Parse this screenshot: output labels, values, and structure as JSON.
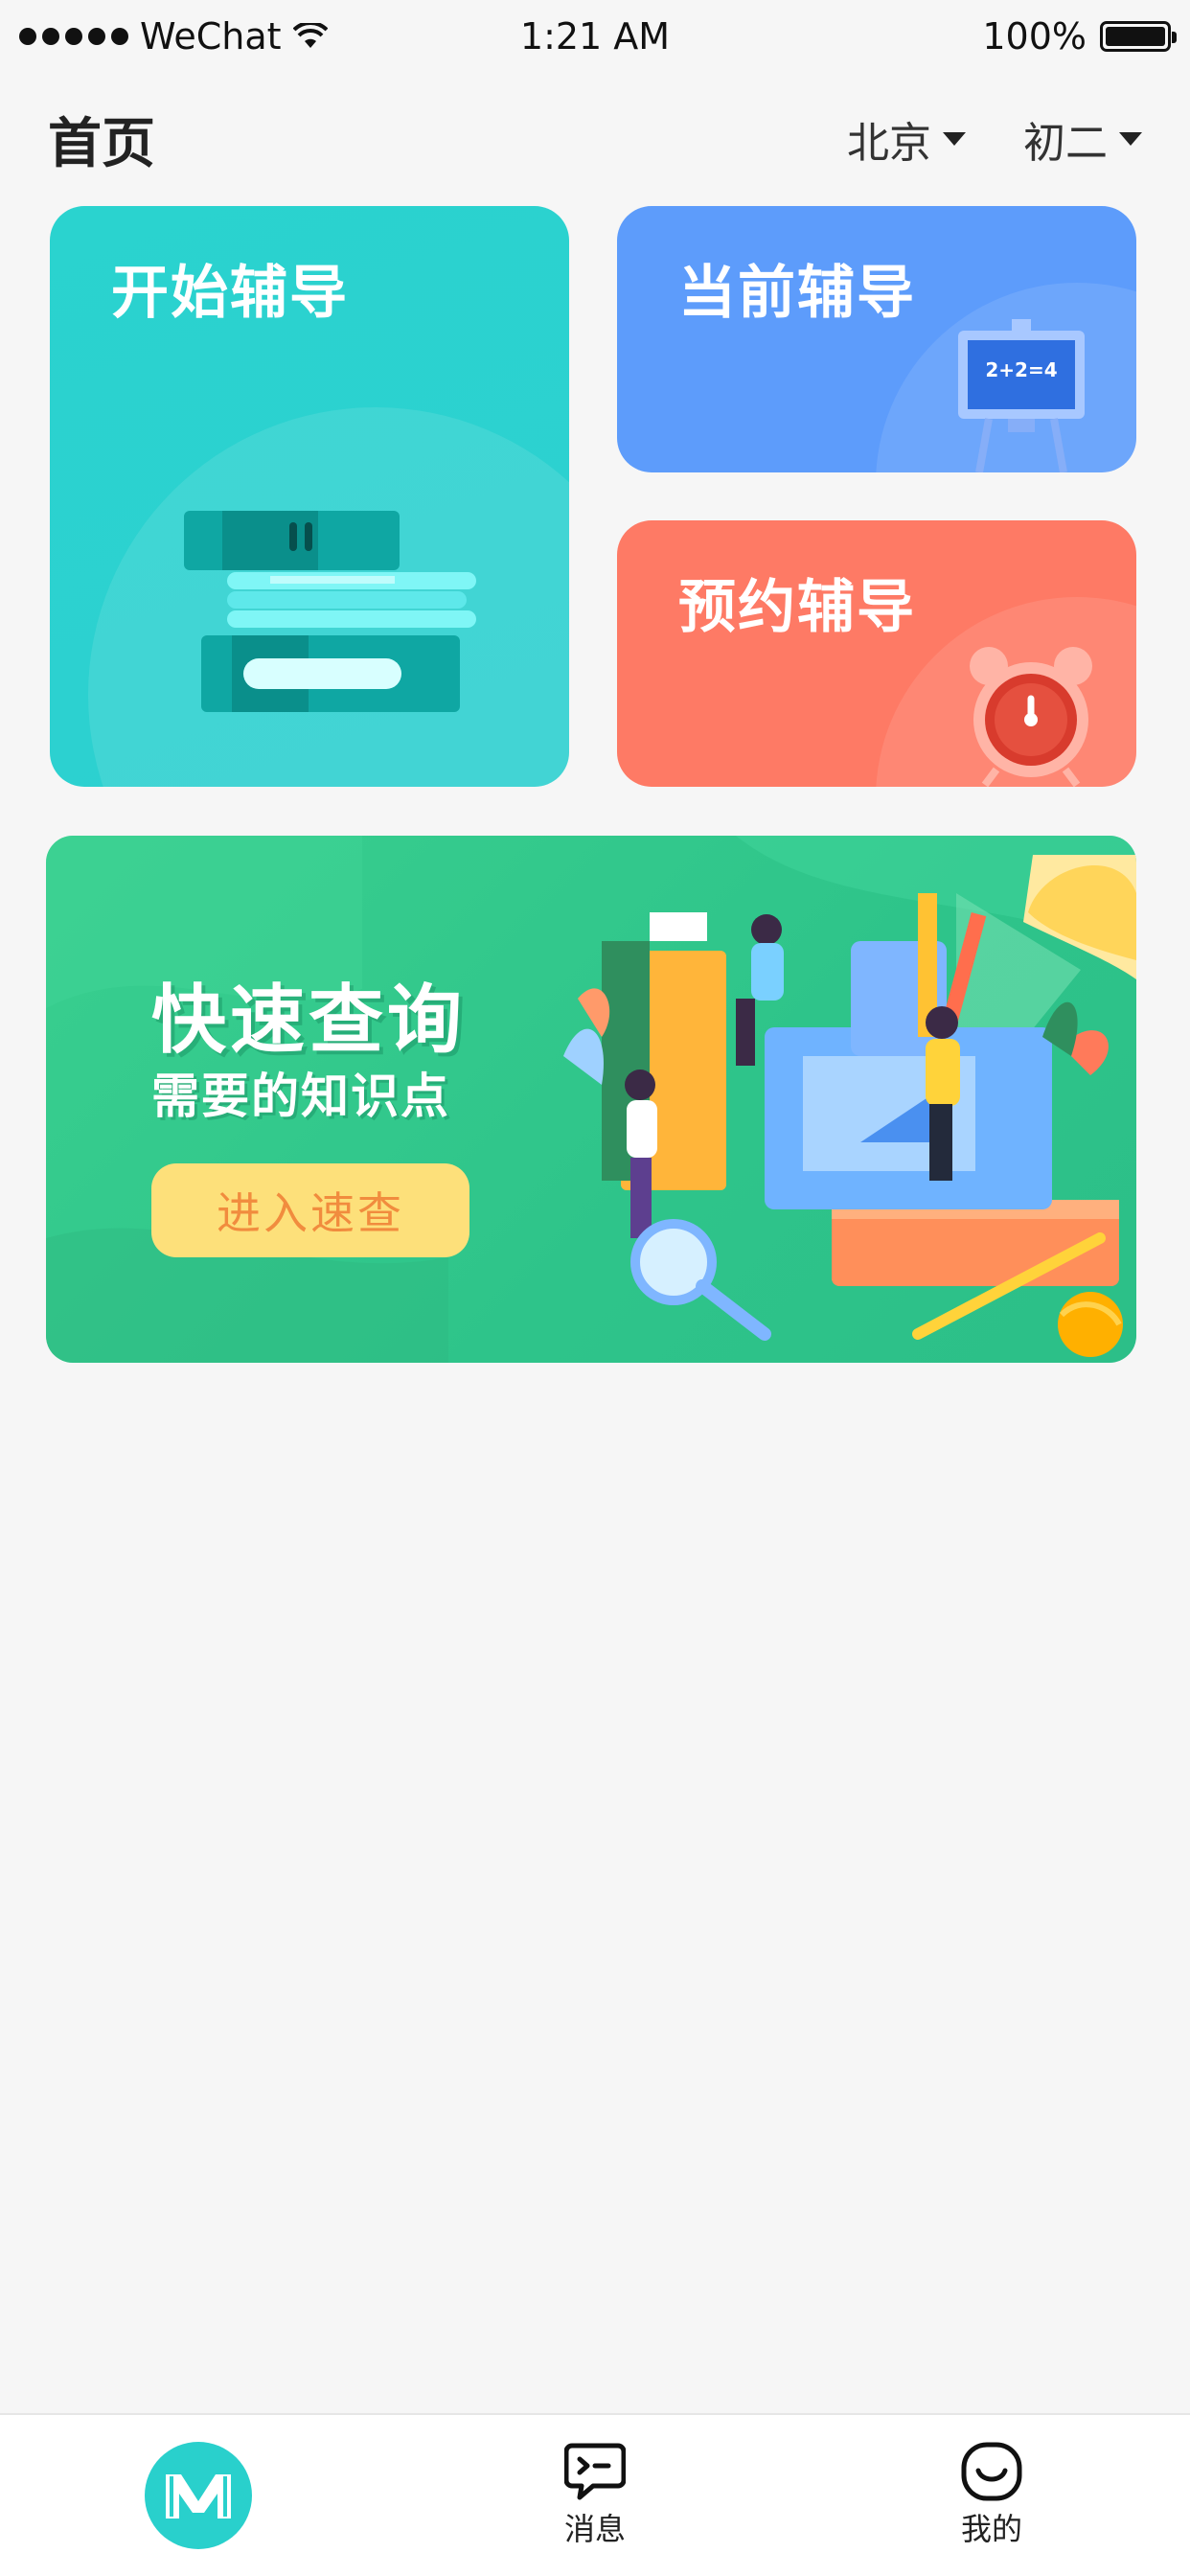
{
  "status_bar": {
    "carrier": "WeChat",
    "time": "1:21 AM",
    "battery": "100%"
  },
  "header": {
    "title": "首页",
    "city": "北京",
    "grade": "初二"
  },
  "cards": {
    "start": {
      "title": "开始辅导"
    },
    "current": {
      "title": "当前辅导",
      "board_text": "2+2=4"
    },
    "reserve": {
      "title": "预约辅导"
    }
  },
  "banner": {
    "title": "快速查询",
    "subtitle": "需要的知识点",
    "button_label": "进入速查"
  },
  "tabbar": {
    "items": [
      {
        "label": "",
        "icon": "app-logo-icon"
      },
      {
        "label": "消息",
        "icon": "message-icon"
      },
      {
        "label": "我的",
        "icon": "smile-face-icon"
      }
    ]
  },
  "colors": {
    "teal": "#2ad3cf",
    "blue": "#5d9cfb",
    "coral": "#fe7a65",
    "green": "#34c98c",
    "button_yellow": "#fde07a",
    "button_text": "#f18c3e"
  }
}
